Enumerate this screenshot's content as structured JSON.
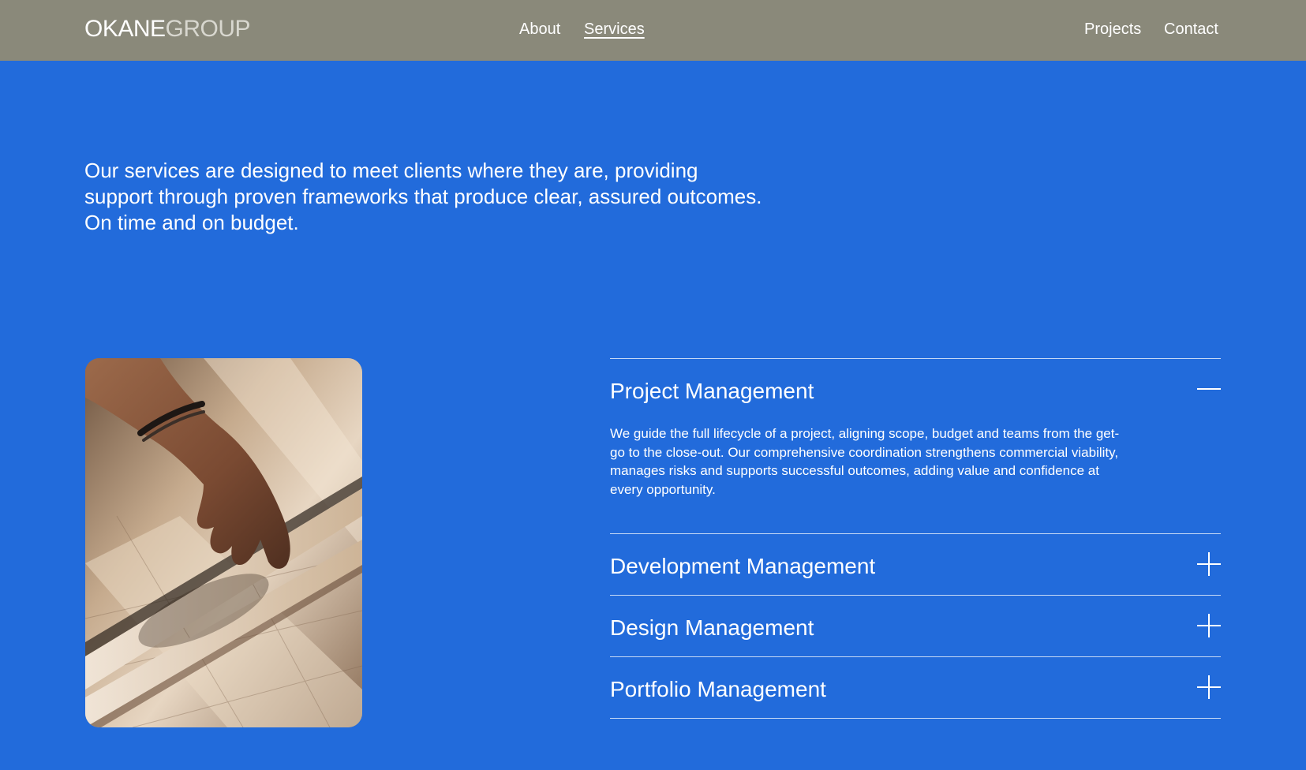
{
  "header": {
    "logo_strong": "OKANE",
    "logo_light": "GROUP",
    "nav": {
      "about": "About",
      "services": "Services",
      "projects": "Projects",
      "contact": "Contact"
    }
  },
  "intro": {
    "text": "Our services are designed to meet clients where they are, providing support through proven frameworks that produce clear, assured outcomes. On time and on budget."
  },
  "services": {
    "items": [
      {
        "title": "Project Management",
        "expanded": true,
        "description": "We guide the full lifecycle of a project, aligning scope, budget and teams from the get-go to the close-out. Our comprehensive coordination strengthens commercial viability, manages risks and supports successful outcomes, adding value and confidence at every opportunity."
      },
      {
        "title": "Development Management",
        "expanded": false
      },
      {
        "title": "Design Management",
        "expanded": false
      },
      {
        "title": "Portfolio Management",
        "expanded": false
      }
    ]
  },
  "colors": {
    "background": "#226bdb",
    "header": "#8a897a",
    "text": "#ffffff",
    "logo_light": "#d8d7cf"
  }
}
